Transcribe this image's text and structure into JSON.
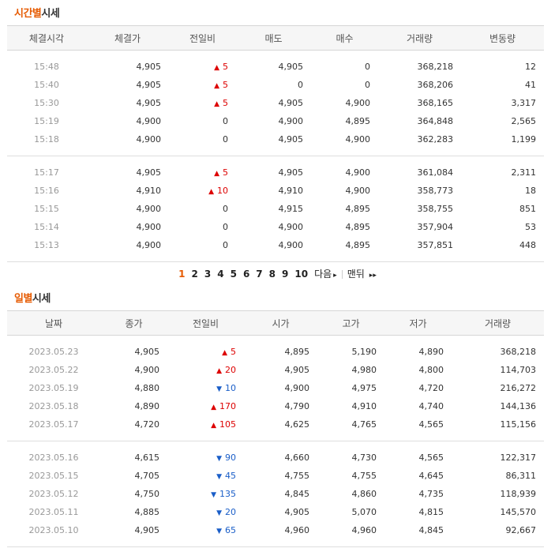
{
  "time_section": {
    "title_hl": "시간별",
    "title_rest": "시세",
    "headers": [
      "체결시각",
      "체결가",
      "전일비",
      "매도",
      "매수",
      "거래량",
      "변동량"
    ],
    "group1": [
      {
        "time": "15:48",
        "price": "4,905",
        "dir": "up",
        "diff": "5",
        "ask": "4,905",
        "bid": "0",
        "vol": "368,218",
        "chg": "12"
      },
      {
        "time": "15:40",
        "price": "4,905",
        "dir": "up",
        "diff": "5",
        "ask": "0",
        "bid": "0",
        "vol": "368,206",
        "chg": "41"
      },
      {
        "time": "15:30",
        "price": "4,905",
        "dir": "up",
        "diff": "5",
        "ask": "4,905",
        "bid": "4,900",
        "vol": "368,165",
        "chg": "3,317"
      },
      {
        "time": "15:19",
        "price": "4,900",
        "dir": "none",
        "diff": "0",
        "ask": "4,900",
        "bid": "4,895",
        "vol": "364,848",
        "chg": "2,565"
      },
      {
        "time": "15:18",
        "price": "4,900",
        "dir": "none",
        "diff": "0",
        "ask": "4,905",
        "bid": "4,900",
        "vol": "362,283",
        "chg": "1,199"
      }
    ],
    "group2": [
      {
        "time": "15:17",
        "price": "4,905",
        "dir": "up",
        "diff": "5",
        "ask": "4,905",
        "bid": "4,900",
        "vol": "361,084",
        "chg": "2,311"
      },
      {
        "time": "15:16",
        "price": "4,910",
        "dir": "up",
        "diff": "10",
        "ask": "4,910",
        "bid": "4,900",
        "vol": "358,773",
        "chg": "18"
      },
      {
        "time": "15:15",
        "price": "4,900",
        "dir": "none",
        "diff": "0",
        "ask": "4,915",
        "bid": "4,895",
        "vol": "358,755",
        "chg": "851"
      },
      {
        "time": "15:14",
        "price": "4,900",
        "dir": "none",
        "diff": "0",
        "ask": "4,900",
        "bid": "4,895",
        "vol": "357,904",
        "chg": "53"
      },
      {
        "time": "15:13",
        "price": "4,900",
        "dir": "none",
        "diff": "0",
        "ask": "4,900",
        "bid": "4,895",
        "vol": "357,851",
        "chg": "448"
      }
    ]
  },
  "pager": {
    "pages": [
      "1",
      "2",
      "3",
      "4",
      "5",
      "6",
      "7",
      "8",
      "9",
      "10"
    ],
    "current": "1",
    "next_label": "다음",
    "last_label": "맨뒤",
    "next_arrow": "▸",
    "last_arrow": "▸▸"
  },
  "daily_section": {
    "title_hl": "일별",
    "title_rest": "시세",
    "headers": [
      "날짜",
      "종가",
      "전일비",
      "시가",
      "고가",
      "저가",
      "거래량"
    ],
    "group1": [
      {
        "date": "2023.05.23",
        "close": "4,905",
        "dir": "up",
        "diff": "5",
        "open": "4,895",
        "high": "5,190",
        "low": "4,890",
        "vol": "368,218"
      },
      {
        "date": "2023.05.22",
        "close": "4,900",
        "dir": "up",
        "diff": "20",
        "open": "4,905",
        "high": "4,980",
        "low": "4,800",
        "vol": "114,703"
      },
      {
        "date": "2023.05.19",
        "close": "4,880",
        "dir": "down",
        "diff": "10",
        "open": "4,900",
        "high": "4,975",
        "low": "4,720",
        "vol": "216,272"
      },
      {
        "date": "2023.05.18",
        "close": "4,890",
        "dir": "up",
        "diff": "170",
        "open": "4,790",
        "high": "4,910",
        "low": "4,740",
        "vol": "144,136"
      },
      {
        "date": "2023.05.17",
        "close": "4,720",
        "dir": "up",
        "diff": "105",
        "open": "4,625",
        "high": "4,765",
        "low": "4,565",
        "vol": "115,156"
      }
    ],
    "group2": [
      {
        "date": "2023.05.16",
        "close": "4,615",
        "dir": "down",
        "diff": "90",
        "open": "4,660",
        "high": "4,730",
        "low": "4,565",
        "vol": "122,317"
      },
      {
        "date": "2023.05.15",
        "close": "4,705",
        "dir": "down",
        "diff": "45",
        "open": "4,755",
        "high": "4,755",
        "low": "4,645",
        "vol": "86,311"
      },
      {
        "date": "2023.05.12",
        "close": "4,750",
        "dir": "down",
        "diff": "135",
        "open": "4,845",
        "high": "4,860",
        "low": "4,735",
        "vol": "118,939"
      },
      {
        "date": "2023.05.11",
        "close": "4,885",
        "dir": "down",
        "diff": "20",
        "open": "4,905",
        "high": "5,070",
        "low": "4,815",
        "vol": "145,570"
      },
      {
        "date": "2023.05.10",
        "close": "4,905",
        "dir": "down",
        "diff": "65",
        "open": "4,960",
        "high": "4,960",
        "low": "4,845",
        "vol": "92,667"
      }
    ]
  },
  "colors": {
    "accent": "#e65a00",
    "up": "#dd0000",
    "down": "#1a5ec8"
  }
}
